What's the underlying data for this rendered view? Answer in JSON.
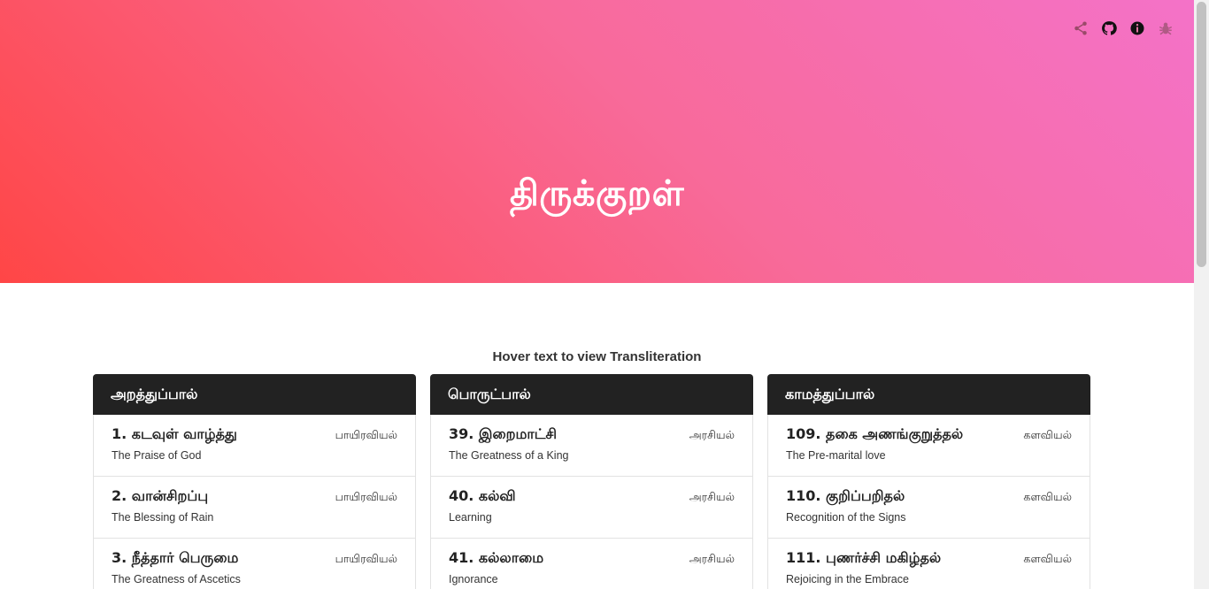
{
  "header": {
    "title": "திருக்குறள்",
    "icons": [
      "share-icon",
      "github-icon",
      "info-icon",
      "bug-icon"
    ]
  },
  "hint": "Hover text to view Transliteration",
  "sections": [
    {
      "title": "அறத்துப்பால்",
      "chapters": [
        {
          "title": "1. கடவுள் வாழ்த்து",
          "subtitle": "The Praise of God",
          "tag": "பாயிரவியல்"
        },
        {
          "title": "2. வான்சிறப்பு",
          "subtitle": "The Blessing of Rain",
          "tag": "பாயிரவியல்"
        },
        {
          "title": "3. நீத்தார் பெருமை",
          "subtitle": "The Greatness of Ascetics",
          "tag": "பாயிரவியல்"
        }
      ]
    },
    {
      "title": "பொருட்பால்",
      "chapters": [
        {
          "title": "39. இறைமாட்சி",
          "subtitle": "The Greatness of a King",
          "tag": "அரசியல்"
        },
        {
          "title": "40. கல்வி",
          "subtitle": "Learning",
          "tag": "அரசியல்"
        },
        {
          "title": "41. கல்லாமை",
          "subtitle": "Ignorance",
          "tag": "அரசியல்"
        }
      ]
    },
    {
      "title": "காமத்துப்பால்",
      "chapters": [
        {
          "title": "109. தகை அணங்குறுத்தல்",
          "subtitle": "The Pre-marital love",
          "tag": "களவியல்"
        },
        {
          "title": "110. குறிப்பறிதல்",
          "subtitle": "Recognition of the Signs",
          "tag": "களவியல்"
        },
        {
          "title": "111. புணர்ச்சி மகிழ்தல்",
          "subtitle": "Rejoicing in the Embrace",
          "tag": "களவியல்"
        }
      ]
    }
  ],
  "colors": {
    "gradient_start": "#ff4646",
    "gradient_end": "#f472c8",
    "header_bg": "#222222"
  }
}
